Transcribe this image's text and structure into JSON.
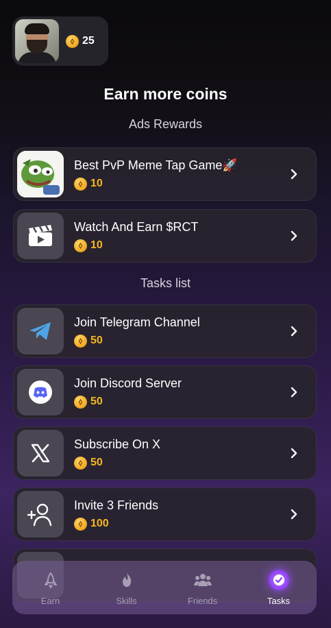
{
  "profile": {
    "balance": "25"
  },
  "header": {
    "title": "Earn more coins"
  },
  "sections": {
    "ads": "Ads Rewards",
    "tasks": "Tasks list"
  },
  "ads": [
    {
      "title": "Best PvP Meme Tap Game🚀",
      "reward": "10",
      "icon": "pepe-frog-image"
    },
    {
      "title": "Watch And Earn $RCT",
      "reward": "10",
      "icon": "clapperboard-icon"
    }
  ],
  "tasks": [
    {
      "title": "Join Telegram Channel",
      "reward": "50",
      "icon": "telegram-icon"
    },
    {
      "title": "Join Discord Server",
      "reward": "50",
      "icon": "discord-icon"
    },
    {
      "title": "Subscribe On X",
      "reward": "50",
      "icon": "x-logo-icon"
    },
    {
      "title": "Invite 3 Friends",
      "reward": "100",
      "icon": "add-user-icon"
    }
  ],
  "nav": {
    "items": [
      {
        "label": "Earn",
        "icon": "rocket-icon"
      },
      {
        "label": "Skills",
        "icon": "fire-icon"
      },
      {
        "label": "Friends",
        "icon": "friends-icon"
      },
      {
        "label": "Tasks",
        "icon": "check-circle-icon"
      }
    ],
    "active": "Tasks"
  },
  "colors": {
    "reward": "#f5b81f",
    "active": "#a050ff"
  }
}
